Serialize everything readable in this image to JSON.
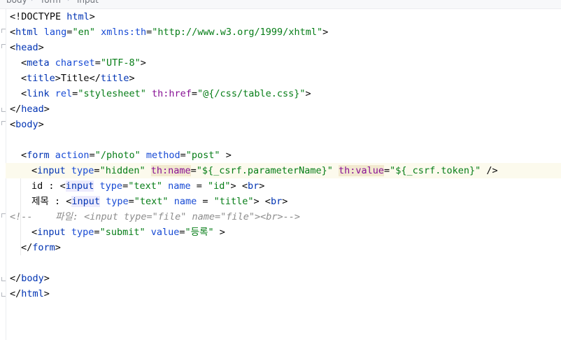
{
  "breadcrumb": {
    "items": [
      "body",
      "form",
      "input"
    ]
  },
  "code": {
    "l1": {
      "a": "<!DOCTYPE ",
      "b": "html",
      "c": ">"
    },
    "l2": {
      "a": "<",
      "b": "html",
      "c": " lang",
      "d": "=",
      "e": "\"en\"",
      "f": " xmlns:th",
      "g": "=",
      "h": "\"http://www.w3.org/1999/xhtml\"",
      "i": ">"
    },
    "l3": {
      "a": "<",
      "b": "head",
      "c": ">"
    },
    "l4": {
      "a": "<",
      "b": "meta",
      "c": " charset",
      "d": "=",
      "e": "\"UTF-8\"",
      "f": ">"
    },
    "l5": {
      "a": "<",
      "b": "title",
      "c": ">",
      "d": "Title",
      "e": "</",
      "f": "title",
      "g": ">"
    },
    "l6": {
      "a": "<",
      "b": "link",
      "c": " rel",
      "d": "=",
      "e": "\"stylesheet\"",
      "f": " ",
      "g": "th:href",
      "h": "=",
      "i": "\"@{/css/table.css}\"",
      "j": ">"
    },
    "l7": {
      "a": "</",
      "b": "head",
      "c": ">"
    },
    "l8": {
      "a": "<",
      "b": "body",
      "c": ">"
    },
    "l10": {
      "a": "<",
      "b": "form",
      "c": " action",
      "d": "=",
      "e": "\"/photo\"",
      "f": " method",
      "g": "=",
      "h": "\"post\"",
      "i": " >"
    },
    "l11": {
      "a": "<",
      "b": "input",
      "c": " type",
      "d": "=",
      "e": "\"hidden\"",
      "f": " ",
      "g": "th:name",
      "h": "=",
      "i": "\"${_csrf.parameterName}\"",
      "j": " ",
      "k": "th:value",
      "l": "=",
      "m": "\"${_csrf.token}\"",
      "n": " />"
    },
    "l12": {
      "a": "id : ",
      "b": "<",
      "c": "input",
      "d": " type",
      "e": "=",
      "f": "\"text\"",
      "g": " name ",
      "h": "=",
      "i": " \"id\"",
      "j": "> ",
      "k": "<",
      "l": "br",
      "m": ">"
    },
    "l13": {
      "a": "제목 : ",
      "b": "<",
      "c": "input",
      "d": " type",
      "e": "=",
      "f": "\"text\"",
      "g": " name ",
      "h": "=",
      "i": " \"title\"",
      "j": "> ",
      "k": "<",
      "l": "br",
      "m": ">"
    },
    "l14": {
      "a": "<!--    파일: <input type=\"file\" name=\"file\"><br>-->"
    },
    "l15": {
      "a": "<",
      "b": "input",
      "c": " type",
      "d": "=",
      "e": "\"submit\"",
      "f": " value",
      "g": "=",
      "h": "\"등록\"",
      "i": " >"
    },
    "l16": {
      "a": "</",
      "b": "form",
      "c": ">"
    },
    "l18": {
      "a": "</",
      "b": "body",
      "c": ">"
    },
    "l19": {
      "a": "</",
      "b": "html",
      "c": ">"
    }
  }
}
